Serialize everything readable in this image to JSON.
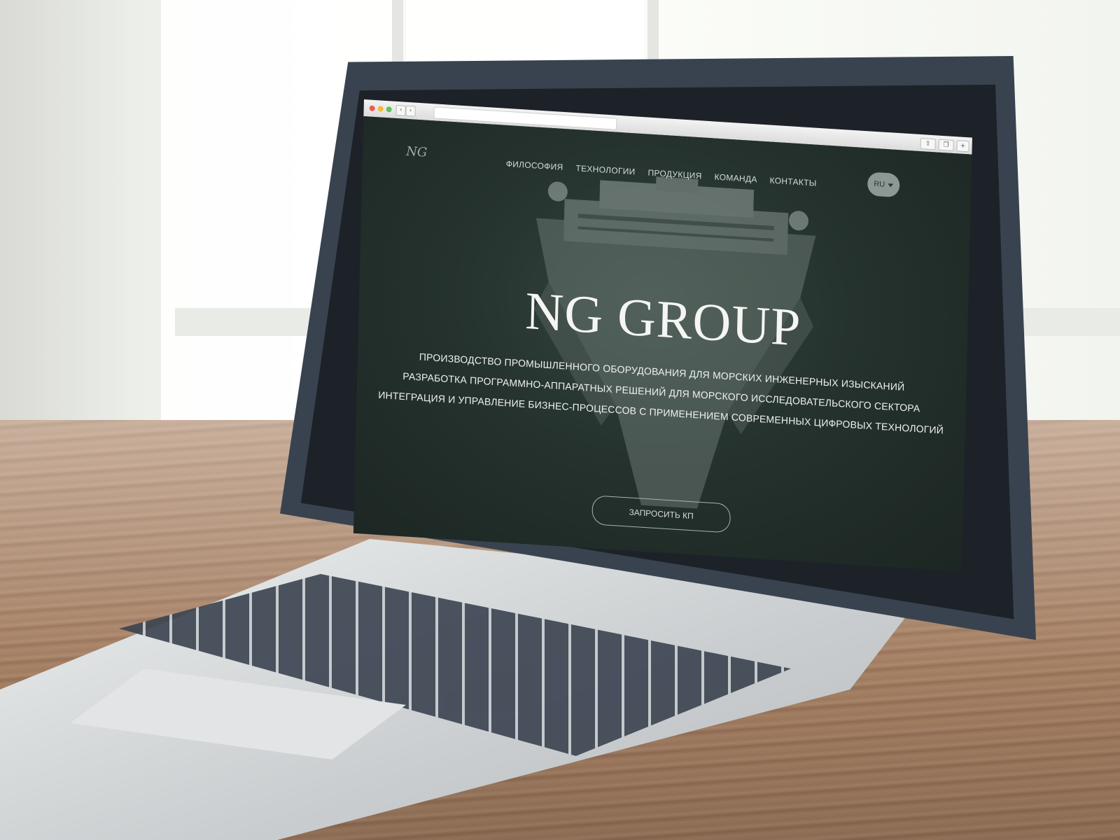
{
  "browser": {
    "back_label": "‹",
    "forward_label": "›",
    "url": "",
    "share_icon": "share-icon",
    "tabs_icon": "tabs-icon",
    "new_tab_label": "+"
  },
  "site": {
    "logo_text": "NG",
    "nav": [
      "ФИЛОСОФИЯ",
      "ТЕХНОЛОГИИ",
      "ПРОДУКЦИЯ",
      "КОМАНДА",
      "КОНТАКТЫ"
    ],
    "language": "RU",
    "title": "NG GROUP",
    "taglines": [
      "ПРОИЗВОДСТВО ПРОМЫШЛЕННОГО ОБОРУДОВАНИЯ ДЛЯ МОРСКИХ ИНЖЕНЕРНЫХ ИЗЫСКАНИЙ",
      "РАЗРАБОТКА ПРОГРАММНО-АППАРАТНЫХ РЕШЕНИЙ ДЛЯ МОРСКОГО ИССЛЕДОВАТЕЛЬСКОГО СЕКТОРА",
      "ИНТЕГРАЦИЯ И УПРАВЛЕНИЕ БИЗНЕС-ПРОЦЕССОВ С ПРИМЕНЕНИЕМ СОВРЕМЕННЫХ ЦИФРОВЫХ ТЕХНОЛОГИЙ"
    ],
    "cta_label": "ЗАПРОСИТЬ КП"
  },
  "colors": {
    "site_background": "#25322e",
    "title": "#f5f6f4",
    "lang_button": "#8c9894"
  }
}
